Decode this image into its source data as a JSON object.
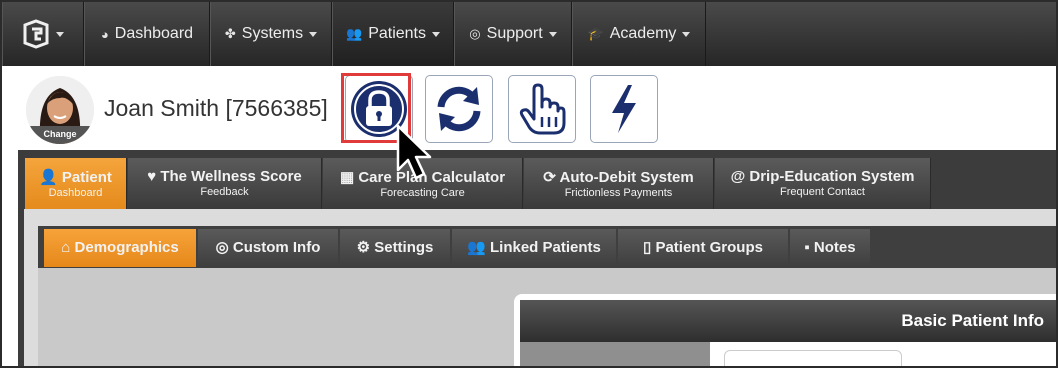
{
  "nav": {
    "items": [
      {
        "label": "Dashboard",
        "icon": "dashboard-icon"
      },
      {
        "label": "Systems",
        "icon": "puzzle-icon"
      },
      {
        "label": "Patients",
        "icon": "users-icon"
      },
      {
        "label": "Support",
        "icon": "lifebuoy-icon"
      },
      {
        "label": "Academy",
        "icon": "graduation-cap-icon"
      }
    ]
  },
  "patient": {
    "name": "Joan Smith [7566385]",
    "avatar_change_label": "Change"
  },
  "actions": [
    "lock-icon",
    "refresh-icon",
    "hand-pointer-icon",
    "bolt-icon"
  ],
  "main_tabs": [
    {
      "title": "Patient",
      "subtitle": "Dashboard",
      "icon": "user-icon"
    },
    {
      "title": "The Wellness Score",
      "subtitle": "Feedback",
      "icon": "heartbeat-icon"
    },
    {
      "title": "Care Plan Calculator",
      "subtitle": "Forecasting Care",
      "icon": "calculator-icon"
    },
    {
      "title": "Auto-Debit System",
      "subtitle": "Frictionless Payments",
      "icon": "refresh-icon"
    },
    {
      "title": "Drip-Education System",
      "subtitle": "Frequent Contact",
      "icon": "at-icon"
    }
  ],
  "sub_tabs": [
    {
      "label": "Demographics",
      "icon": "home-icon"
    },
    {
      "label": "Custom Info",
      "icon": "target-icon"
    },
    {
      "label": "Settings",
      "icon": "gear-icon"
    },
    {
      "label": "Linked Patients",
      "icon": "users-icon"
    },
    {
      "label": "Patient Groups",
      "icon": "trash-icon"
    },
    {
      "label": "Notes",
      "icon": "note-icon"
    }
  ],
  "card": {
    "title": "Basic Patient Info"
  },
  "colors": {
    "accent": "#f09a2e",
    "highlight": "#e03a3a",
    "icon_blue": "#1b2f6e"
  }
}
